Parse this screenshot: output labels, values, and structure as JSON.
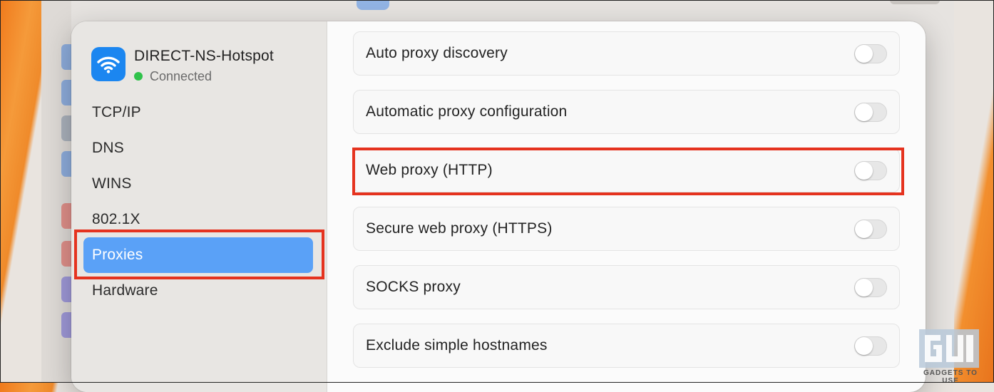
{
  "network": {
    "name": "DIRECT-NS-Hotspot",
    "status": "Connected"
  },
  "sidebar": {
    "items": [
      {
        "label": "TCP/IP"
      },
      {
        "label": "DNS"
      },
      {
        "label": "WINS"
      },
      {
        "label": "802.1X"
      },
      {
        "label": "Proxies",
        "active": true
      },
      {
        "label": "Hardware"
      }
    ]
  },
  "proxies": [
    {
      "label": "Auto proxy discovery",
      "enabled": false
    },
    {
      "label": "Automatic proxy configuration",
      "enabled": false
    },
    {
      "label": "Web proxy (HTTP)",
      "enabled": false
    },
    {
      "label": "Secure web proxy (HTTPS)",
      "enabled": false
    },
    {
      "label": "SOCKS proxy",
      "enabled": false
    },
    {
      "label": "Exclude simple hostnames",
      "enabled": false
    }
  ],
  "watermark": {
    "text": "GADGETS TO USE"
  },
  "colors": {
    "accent": "#5aa1f7",
    "highlight": "#e5331f",
    "connected": "#2fc24a",
    "wifi_tile": "#1b86f0"
  }
}
